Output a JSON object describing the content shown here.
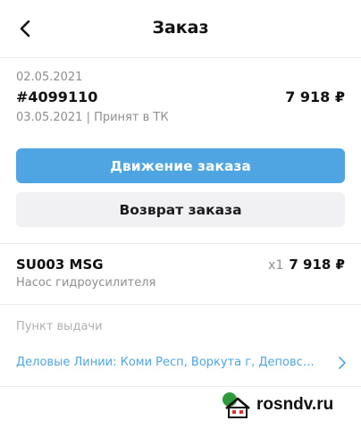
{
  "header": {
    "title": "Заказ",
    "back_icon": "chevron-left-icon"
  },
  "order": {
    "created_date": "02.05.2021",
    "number": "#4099110",
    "total": "7 918 ₽",
    "status_line": "03.05.2021 | Принят в ТК"
  },
  "actions": {
    "track_label": "Движение заказа",
    "return_label": "Возврат заказа"
  },
  "items": [
    {
      "sku": "SU003 MSG",
      "description": "Насос гидроусилителя",
      "quantity": "x1",
      "price": "7 918 ₽"
    }
  ],
  "pickup": {
    "label": "Пункт выдачи",
    "address": "Деловые Линии: Коми Респ, Воркута г, Деповской пер,..."
  },
  "watermark": {
    "text": "rosndv.ru"
  },
  "colors": {
    "accent": "#4fa5e1",
    "secondary_button_bg": "#f1f1f3",
    "muted_text": "#8e8e93"
  }
}
